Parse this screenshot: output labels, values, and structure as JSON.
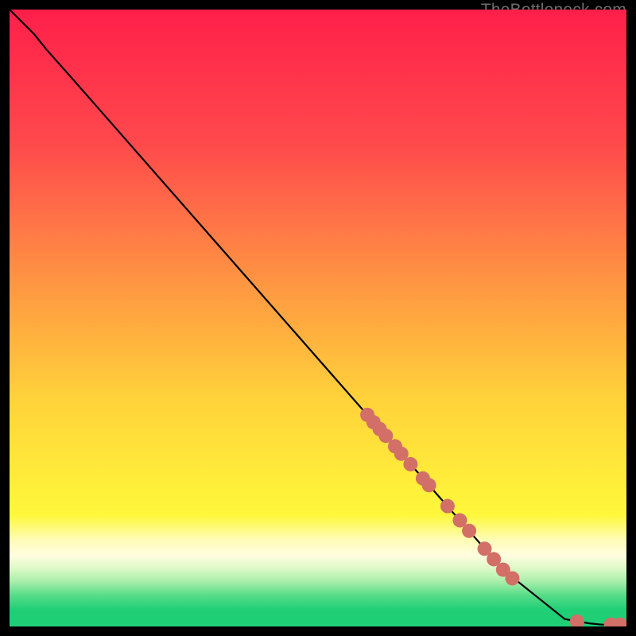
{
  "watermark": "TheBottleneck.com",
  "chart_data": {
    "type": "line",
    "title": "",
    "xlabel": "",
    "ylabel": "",
    "xlim": [
      0,
      100
    ],
    "ylim": [
      0,
      100
    ],
    "grid": false,
    "curve": {
      "name": "bottleneck-curve",
      "color": "#000000",
      "x": [
        0,
        4,
        6,
        10,
        20,
        30,
        40,
        50,
        60,
        70,
        80,
        90,
        94,
        96,
        98,
        100
      ],
      "y": [
        100,
        96,
        93.5,
        89,
        77.6,
        66.2,
        54.8,
        43.4,
        32,
        20.6,
        9.2,
        1.2,
        0.5,
        0.3,
        0.3,
        0.3
      ]
    },
    "scatter": {
      "name": "highlight-points",
      "color": "#D27068",
      "radius_px": 9,
      "x": [
        58,
        59,
        60,
        61,
        62.5,
        63.5,
        65,
        67,
        68,
        71,
        73,
        74.5,
        77,
        78.5,
        80,
        81.5,
        92,
        97.5,
        99
      ],
      "y": [
        34.3,
        33.1,
        32.0,
        30.9,
        29.2,
        28.0,
        26.3,
        24.0,
        22.9,
        19.5,
        17.2,
        15.5,
        12.6,
        10.9,
        9.2,
        7.8,
        0.8,
        0.3,
        0.3
      ]
    },
    "background_gradient": {
      "type": "vertical",
      "stops": [
        {
          "y_pct": 0,
          "color": "#ff1f4a"
        },
        {
          "y_pct": 22,
          "color": "#ff4a4c"
        },
        {
          "y_pct": 45,
          "color": "#ff9842"
        },
        {
          "y_pct": 63,
          "color": "#ffd23a"
        },
        {
          "y_pct": 77,
          "color": "#ffee3a"
        },
        {
          "y_pct": 82,
          "color": "#fff83c"
        },
        {
          "y_pct": 86,
          "color": "#fffcb8"
        },
        {
          "y_pct": 88.5,
          "color": "#fffde0"
        },
        {
          "y_pct": 90.5,
          "color": "#dff9c8"
        },
        {
          "y_pct": 92.5,
          "color": "#aef0ad"
        },
        {
          "y_pct": 95,
          "color": "#55dc88"
        },
        {
          "y_pct": 97.3,
          "color": "#1fcf76"
        },
        {
          "y_pct": 100,
          "color": "#1fcf76"
        }
      ]
    }
  }
}
